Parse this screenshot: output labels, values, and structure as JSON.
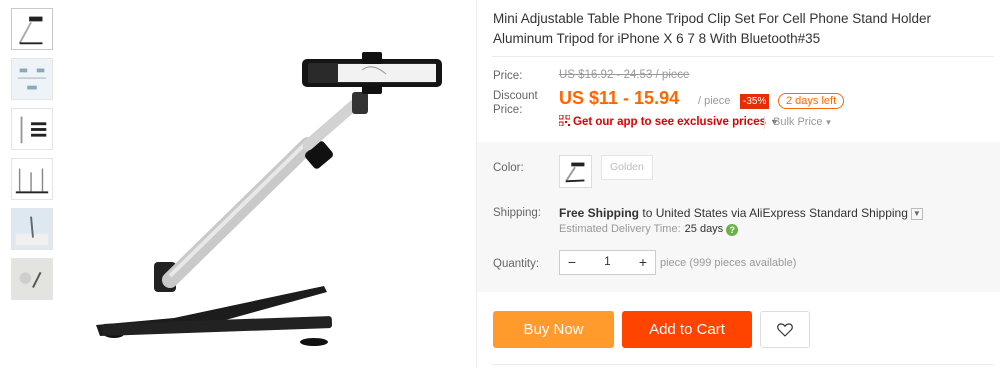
{
  "product": {
    "title": "Mini Adjustable Table Phone Tripod Clip Set For Cell Phone Stand Holder Aluminum Tripod for iPhone X 6 7 8 With Bluetooth#35"
  },
  "price": {
    "label": "Price:",
    "original": "US $16.92 - 24.53 / piece",
    "discount_label_line1": "Discount",
    "discount_label_line2": "Price:",
    "current": "US $11 - 15.94",
    "per_unit": "/ piece",
    "discount_badge": "-35%",
    "time_left": "2 days left"
  },
  "promo": {
    "app_link": "Get our app to see exclusive prices",
    "bulk_price": "Bulk Price"
  },
  "color": {
    "label": "Color:",
    "options": [
      "Golden"
    ]
  },
  "shipping": {
    "label": "Shipping:",
    "free_shipping": "Free Shipping",
    "to": "to",
    "country": "United States",
    "via": "via",
    "method": "AliExpress Standard Shipping",
    "estimated_label": "Estimated Delivery Time:",
    "estimated_value": "25 days"
  },
  "quantity": {
    "label": "Quantity:",
    "value": "1",
    "minus": "−",
    "plus": "+",
    "available": "piece (999 pieces available)"
  },
  "actions": {
    "buy_now": "Buy Now",
    "add_to_cart": "Add to Cart"
  },
  "colors": {
    "buy_now_bg": "#ff9a2c",
    "add_to_cart_bg": "#ff4400",
    "price_orange": "#ff6600",
    "discount_red": "#e62e04"
  },
  "icons": [
    "qr-code-icon",
    "chevron-down-icon",
    "help-icon",
    "heart-icon"
  ]
}
